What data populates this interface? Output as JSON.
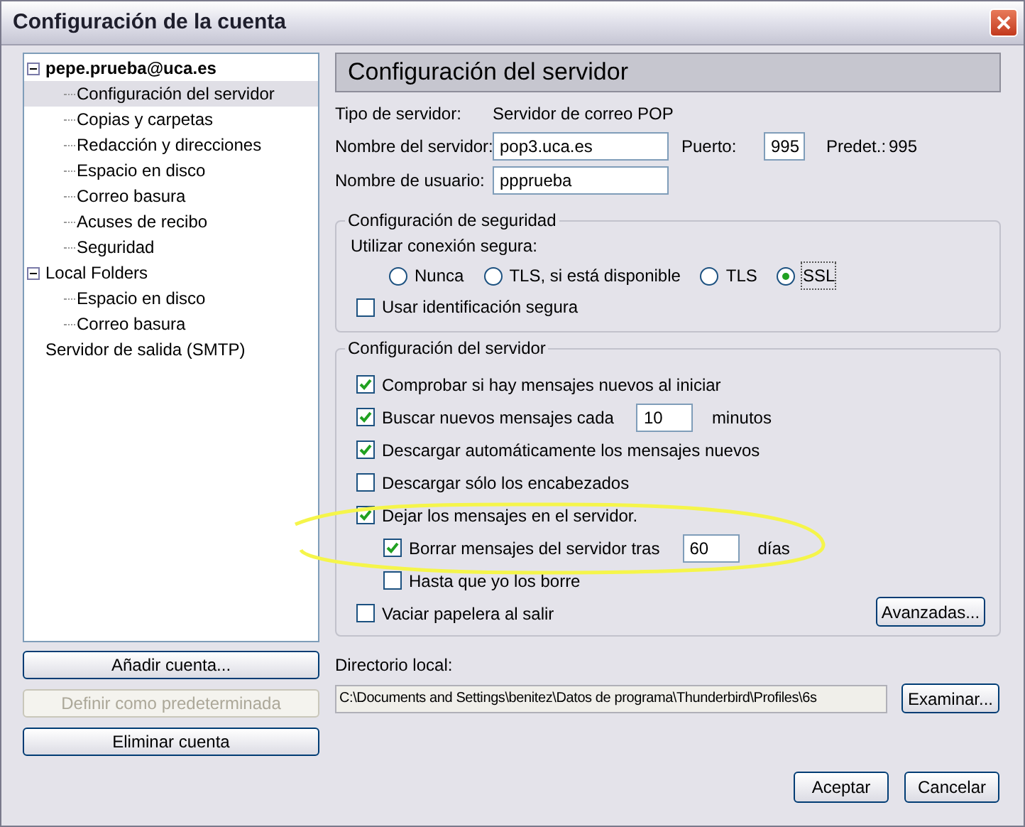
{
  "window": {
    "title": "Configuración de la cuenta"
  },
  "tree": [
    {
      "label": "pepe.prueba@uca.es",
      "bold": true,
      "expanded": true,
      "selected": false,
      "children": [
        {
          "label": "Configuración del servidor",
          "selected": true
        },
        {
          "label": "Copias y carpetas",
          "selected": false
        },
        {
          "label": "Redacción y direcciones",
          "selected": false
        },
        {
          "label": "Espacio en disco",
          "selected": false
        },
        {
          "label": "Correo basura",
          "selected": false
        },
        {
          "label": "Acuses de recibo",
          "selected": false
        },
        {
          "label": "Seguridad",
          "selected": false
        }
      ]
    },
    {
      "label": "Local Folders",
      "bold": false,
      "expanded": true,
      "selected": false,
      "children": [
        {
          "label": "Espacio en disco",
          "selected": false
        },
        {
          "label": "Correo basura",
          "selected": false
        }
      ]
    },
    {
      "label": "Servidor de salida (SMTP)",
      "bold": false,
      "selected": false
    }
  ],
  "account_buttons": [
    {
      "label": "Añadir cuenta...",
      "disabled": false
    },
    {
      "label": "Definir como predeterminada",
      "disabled": true
    },
    {
      "label": "Eliminar cuenta",
      "disabled": false
    }
  ],
  "panel_title": "Configuración del servidor",
  "server_type": {
    "label": "Tipo de servidor:",
    "value": "Servidor de correo POP"
  },
  "server_name": {
    "label": "Nombre del servidor:",
    "value": "pop3.uca.es"
  },
  "port": {
    "label": "Puerto:",
    "value": "995"
  },
  "default_port": {
    "label": "Predet.:",
    "value": "995"
  },
  "username": {
    "label": "Nombre de usuario:",
    "value": "ppprueba"
  },
  "security": {
    "title": "Configuración de seguridad",
    "prompt": "Utilizar conexión segura:",
    "options": [
      {
        "label": "Nunca",
        "selected": false
      },
      {
        "label": "TLS, si está disponible",
        "selected": false
      },
      {
        "label": "TLS",
        "selected": false
      },
      {
        "label": "SSL",
        "selected": true
      }
    ],
    "secure_auth": {
      "label": "Usar identificación segura",
      "checked": false
    }
  },
  "server_settings": {
    "title": "Configuración del servidor",
    "options": [
      {
        "kind": "checkbox",
        "label": "Comprobar si hay mensajes nuevos al iniciar",
        "checked": true
      },
      {
        "kind": "interval",
        "label": "Buscar nuevos mensajes cada",
        "checked": true,
        "value": "10",
        "unit": "minutos"
      },
      {
        "kind": "checkbox",
        "label": "Descargar automáticamente los mensajes nuevos",
        "checked": true
      },
      {
        "kind": "checkbox",
        "label": "Descargar sólo los encabezados",
        "checked": false
      },
      {
        "kind": "checkbox",
        "label": "Dejar los mensajes en el servidor.",
        "checked": true,
        "children": [
          {
            "kind": "interval",
            "label": "Borrar mensajes del servidor tras",
            "checked": true,
            "value": "60",
            "unit": "días"
          },
          {
            "kind": "checkbox",
            "label": "Hasta que yo los borre",
            "checked": false
          }
        ]
      },
      {
        "kind": "checkbox",
        "label": "Vaciar papelera al salir",
        "checked": false
      }
    ],
    "advanced_button": "Avanzadas..."
  },
  "local_dir": {
    "label": "Directorio local:",
    "value": "C:\\Documents and Settings\\benitez\\Datos de programa\\Thunderbird\\Profiles\\6s",
    "button": "Examinar..."
  },
  "buttons": [
    "Aceptar",
    "Cancelar"
  ]
}
